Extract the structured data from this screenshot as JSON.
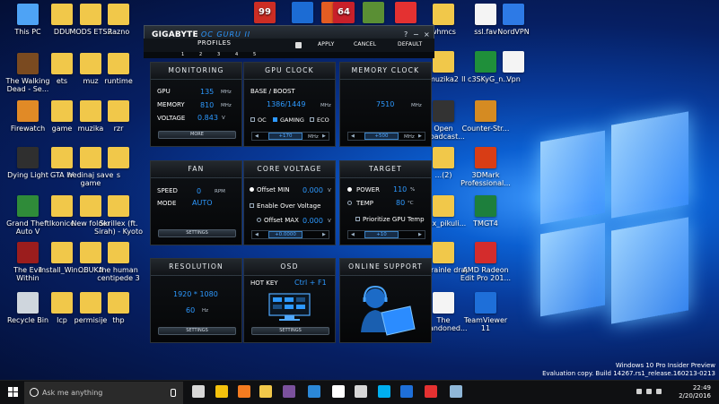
{
  "desktop": {
    "icons": [
      {
        "label": "This PC",
        "color": "#4ea3f5"
      },
      {
        "label": "DDU",
        "color": "#f1c84a"
      },
      {
        "label": "MODS ETS2",
        "color": "#f1c84a"
      },
      {
        "label": "Razno",
        "color": "#f1c84a"
      },
      {
        "label": "The Walking Dead - Se...",
        "color": "#7a4a20"
      },
      {
        "label": "ets",
        "color": "#f1c84a"
      },
      {
        "label": "muz",
        "color": "#f1c84a"
      },
      {
        "label": "runtime",
        "color": "#f1c84a"
      },
      {
        "label": "Firewatch",
        "color": "#e18a26"
      },
      {
        "label": "game",
        "color": "#f1c84a"
      },
      {
        "label": "muzika",
        "color": "#f1c84a"
      },
      {
        "label": "rzr",
        "color": "#f1c84a"
      },
      {
        "label": "Dying Light",
        "color": "#2f2f2f"
      },
      {
        "label": "GTA IV",
        "color": "#f1c84a"
      },
      {
        "label": "nedinaj save game",
        "color": "#f1c84a"
      },
      {
        "label": "s",
        "color": "#f1c84a"
      },
      {
        "label": "Grand Theft Auto V",
        "color": "#2f8b39"
      },
      {
        "label": "Ikonice",
        "color": "#f1c84a"
      },
      {
        "label": "New folder",
        "color": "#f1c84a"
      },
      {
        "label": "Skrillex (ft. Sirah) - Kyoto",
        "color": "#f1c84a"
      },
      {
        "label": "The Evil Within",
        "color": "#9b1d1d"
      },
      {
        "label": "Install_Win...",
        "color": "#f1c84a"
      },
      {
        "label": "OBUKA",
        "color": "#f1c84a"
      },
      {
        "label": "the human centipede 3",
        "color": "#f1c84a"
      },
      {
        "label": "Recycle Bin",
        "color": "#cfd6dd"
      },
      {
        "label": "lcp",
        "color": "#f1c84a"
      },
      {
        "label": "permisije",
        "color": "#f1c84a"
      },
      {
        "label": "thp",
        "color": "#f1c84a"
      },
      {
        "label": "whmcs",
        "color": "#f1c84a"
      },
      {
        "label": "ssl.fav",
        "color": "#f4f4f4"
      },
      {
        "label": "NordVPN",
        "color": "#2d7ae6"
      },
      {
        "label": "muzika2",
        "color": "#f1c84a"
      },
      {
        "label": "ll c3SKyG_n...",
        "color": "#1f8f3a"
      },
      {
        "label": "Vpn",
        "color": "#f4f4f4"
      },
      {
        "label": "Open Broadcast...",
        "color": "#333333"
      },
      {
        "label": "Counter-Str...",
        "color": "#d58b22"
      },
      {
        "label": "...(2)",
        "color": "#f1c84a"
      },
      {
        "label": "3DMark Professional...",
        "color": "#d83d15"
      },
      {
        "label": "...ux_pikuli...",
        "color": "#f1c84a"
      },
      {
        "label": "TMGT4",
        "color": "#1d7f3c"
      },
      {
        "label": "...brainle draj",
        "color": "#f1c84a"
      },
      {
        "label": "AMD Radeon Edit Pro 201...",
        "color": "#d42c2c"
      },
      {
        "label": "The Abandoned...",
        "color": "#f4f4f4"
      },
      {
        "label": "TeamViewer 11",
        "color": "#1e6fd9"
      }
    ],
    "topbar_icons": [
      {
        "name": "gpu-z-icon",
        "text": "99",
        "color": "#cc2d24"
      },
      {
        "name": "game-icon-1",
        "text": "",
        "color": "#1c6cd4"
      },
      {
        "name": "game-icon-2",
        "text": "",
        "color": "#e35c22"
      },
      {
        "name": "game-icon-3",
        "text": "64",
        "color": "#c8202a"
      },
      {
        "name": "minecraft-icon",
        "text": "",
        "color": "#5a8f34"
      },
      {
        "name": "app-icon",
        "text": "",
        "color": "#e43131"
      }
    ],
    "watermark": {
      "line1": "Windows 10 Pro Insider Preview",
      "line2": "Evaluation copy. Build 14267.rs1_release.160213-0213"
    }
  },
  "app": {
    "brand": "GIGABYTE",
    "title": "OC GURU II",
    "window_buttons": [
      "?",
      "−",
      "×"
    ],
    "profiles_label": "PROFILES",
    "profile_tabs": [
      "1",
      "2",
      "3",
      "4",
      "5"
    ],
    "apply_label": "APPLY",
    "cancel_label": "CANCEL",
    "default_label": "DEFAULT",
    "accent": "#2d98ff",
    "monitoring": {
      "title": "MONITORING",
      "gpu_label": "GPU",
      "gpu_value": "135",
      "gpu_unit": "MHz",
      "memory_label": "MEMORY",
      "memory_value": "810",
      "memory_unit": "MHz",
      "voltage_label": "VOLTAGE",
      "voltage_value": "0.843",
      "voltage_unit": "V",
      "more_label": "MORE"
    },
    "gpu_clock": {
      "title": "GPU CLOCK",
      "base_boost_label": "BASE / BOOST",
      "value": "1386/1449",
      "unit": "MHz",
      "mode_oc": "OC",
      "mode_gaming": "GAMING",
      "mode_eco": "ECO",
      "slider_value": "+170",
      "slider_unit": "MHz"
    },
    "memory_clock": {
      "title": "MEMORY CLOCK",
      "value": "7510",
      "unit": "MHz",
      "slider_value": "+500",
      "slider_unit": "MHz"
    },
    "fan": {
      "title": "FAN",
      "speed_label": "SPEED",
      "speed_value": "0",
      "speed_unit": "RPM",
      "mode_label": "MODE",
      "mode_value": "AUTO",
      "settings_label": "SETTINGS"
    },
    "core_voltage": {
      "title": "CORE VOLTAGE",
      "offset_min_label": "Offset MIN",
      "offset_min_value": "0.000",
      "offset_min_unit": "V",
      "enable_over_voltage_label": "Enable Over Voltage",
      "offset_max_label": "Offset MAX",
      "offset_max_value": "0.000",
      "offset_max_unit": "V",
      "slider_value": "+0.0000"
    },
    "target": {
      "title": "TARGET",
      "power_label": "POWER",
      "power_value": "110",
      "power_unit": "%",
      "temp_label": "TEMP",
      "temp_value": "80",
      "temp_unit": "°C",
      "prioritize_label": "Prioritize GPU Temp",
      "slider_value": "+10"
    },
    "resolution": {
      "title": "RESOLUTION",
      "value": "1920 * 1080",
      "refresh_value": "60",
      "refresh_unit": "Hz",
      "settings_label": "SETTINGS"
    },
    "osd": {
      "title": "OSD",
      "hotkey_label": "HOT KEY",
      "hotkey_value": "Ctrl + F1",
      "settings_label": "SETTINGS"
    },
    "online_support": {
      "title": "ONLINE SUPPORT"
    }
  },
  "taskbar": {
    "search_placeholder": "Ask me anything",
    "apps": [
      {
        "name": "task-view-icon",
        "color": "#d7d7d7",
        "active": false
      },
      {
        "name": "chrome-icon",
        "color": "#f4c20d",
        "active": false
      },
      {
        "name": "firefox-icon",
        "color": "#f57c20",
        "active": false
      },
      {
        "name": "file-explorer-icon",
        "color": "#f1c84a",
        "active": false
      },
      {
        "name": "viber-icon",
        "color": "#7b519d",
        "active": false
      },
      {
        "name": "edge-icon",
        "color": "#2b88d8",
        "active": false
      },
      {
        "name": "store-icon",
        "color": "#ffffff",
        "active": false
      },
      {
        "name": "camera-icon",
        "color": "#d7d7d7",
        "active": false
      },
      {
        "name": "skype-icon",
        "color": "#00aff0",
        "active": false
      },
      {
        "name": "teamviewer-taskbar-icon",
        "color": "#1e6fd9",
        "active": false
      },
      {
        "name": "app-taskbar-icon",
        "color": "#e43131",
        "active": false
      },
      {
        "name": "oc-guru-taskbar-icon",
        "color": "#8fb7d8",
        "active": true
      }
    ],
    "time": "22:49",
    "date": "2/20/2016"
  }
}
